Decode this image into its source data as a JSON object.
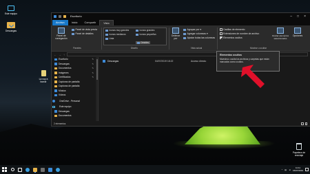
{
  "desktop": {
    "icons": [
      {
        "label": "Este equipo",
        "icon": "pc-icon"
      },
      {
        "label": "Descargas",
        "icon": "downloads-folder-icon"
      },
      {
        "label": "La voy a borrar",
        "icon": "file-icon"
      },
      {
        "label": "Papelera de reciclaje",
        "icon": "recycle-bin-icon"
      }
    ]
  },
  "window": {
    "title": "Escritorio",
    "tabs": [
      "Archivo",
      "Inicio",
      "Compartir",
      "Vista"
    ],
    "active_tab": "Vista",
    "ribbon": {
      "panes": {
        "nav_pane": "Panel de navegación",
        "preview": "Panel de vista previa",
        "details": "Panel de detalles",
        "group": "Paneles"
      },
      "layout": {
        "items": [
          "Iconos muy grandes",
          "Iconos grandes",
          "Iconos medianos",
          "Iconos pequeños",
          "Lista",
          "Detalles"
        ],
        "selected": "Detalles",
        "group": "Diseño"
      },
      "current_view": {
        "sort": "Ordenar por",
        "group_by": "Agrupar por",
        "add_columns": "Agregar columnas",
        "fit_columns": "Ajustar todas las columnas",
        "group": "Vista actual"
      },
      "show_hide": {
        "checkboxes": [
          {
            "label": "Casillas de elemento",
            "checked": false
          },
          {
            "label": "Extensiones de nombre de archivo",
            "checked": false
          },
          {
            "label": "Elementos ocultos",
            "checked": true
          }
        ],
        "hide_selected": "Ocultar elementos seleccionados",
        "options": "Opciones",
        "group": "Mostrar u ocultar"
      }
    },
    "nav_items": [
      {
        "label": "Escritorio",
        "icon": "desktop-folder-icon",
        "pinned": true
      },
      {
        "label": "Descargas",
        "icon": "downloads-folder-icon",
        "pinned": true
      },
      {
        "label": "Documentos",
        "icon": "documents-folder-icon",
        "pinned": true
      },
      {
        "label": "Imágenes",
        "icon": "pictures-folder-icon",
        "pinned": true
      },
      {
        "label": "Certificados",
        "icon": "folder-icon",
        "pinned": true
      },
      {
        "label": "Capturas de pantalla",
        "icon": "folder-icon",
        "pinned": false
      },
      {
        "label": "Capturas de pantalla",
        "icon": "folder-icon",
        "pinned": false
      },
      {
        "label": "Música",
        "icon": "music-folder-icon",
        "pinned": false
      },
      {
        "label": "Vídeos",
        "icon": "videos-folder-icon",
        "pinned": false
      },
      {
        "label": "OneDrive - Personal",
        "icon": "onedrive-icon",
        "pinned": false
      },
      {
        "label": "Este equipo",
        "icon": "pc-icon",
        "pinned": false
      },
      {
        "label": "Descargas",
        "icon": "downloads-folder-icon",
        "pinned": false
      },
      {
        "label": "Documentos",
        "icon": "documents-folder-icon",
        "pinned": false
      }
    ],
    "files": [
      {
        "name": "Descargas",
        "date": "04/07/2019 18:22",
        "type": "Acceso directo",
        "size": "1 KB"
      }
    ],
    "status": "2 elementos",
    "tooltip": {
      "title": "Elementos ocultos",
      "body": "Muestra u oculta los archivos y carpetas que están marcados como ocultos."
    }
  },
  "taskbar": {
    "time": "11:11",
    "date": "15/07/2019"
  },
  "colors": {
    "accent": "#1979ca",
    "arrow": "#e0102a",
    "tent": "#b6f045"
  }
}
